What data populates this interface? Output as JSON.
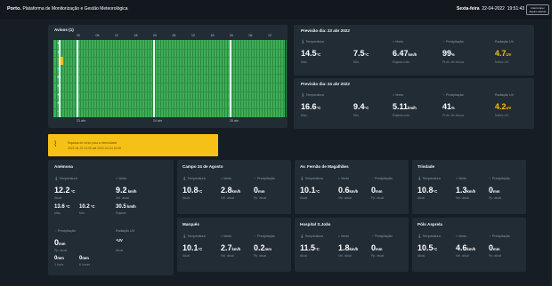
{
  "header": {
    "city": "Porto",
    "subtitle": "Plataforma de Monitorização e Gestão Meteorológica",
    "day": "Sexta-feira",
    "date": "22-04-2022",
    "time": "19:51:43",
    "button": "Interromper Alguns alertas"
  },
  "alerts_card": {
    "title": "Avisos (1)",
    "hours": [
      "00",
      "06",
      "12",
      "18",
      "00",
      "06",
      "12",
      "18",
      "00",
      "06",
      "12"
    ],
    "days": [
      "23 abr",
      "24 abr",
      "25 abr"
    ],
    "row_icons": [
      "wind-icon",
      "rain-icon",
      "thunderstorm-icon",
      "snow-icon",
      "fog-icon",
      "heat-icon",
      "cold-icon",
      "sea-icon",
      "fire-icon"
    ],
    "colors": {
      "level_green": "#3cae57",
      "level_yellow": "#f5c117"
    }
  },
  "alert_banner": {
    "line1": "Rajadas de vento para a intensidade",
    "line2": "2022-04-22 13:00 até 2022-04-24 19:00"
  },
  "forecast": [
    {
      "title": "Previsão dia: 23 abr 2022",
      "labels": {
        "temp": "Temperatura",
        "wind": "Vento",
        "precip": "Precipitação",
        "uv": "Radiação UV"
      },
      "max_temp": "14.5",
      "min_temp": "7.5",
      "temp_unit": "°C",
      "wind": "6.47",
      "wind_unit": "km/h",
      "precip": "99",
      "precip_unit": "%",
      "uv": "4.7",
      "uv_unit": "UV",
      "subs": {
        "max": "Máx.",
        "min": "Mín.",
        "gust": "Rajada máx",
        "prob": "Prob. de chuva",
        "uv_idx": "Índice UV"
      }
    },
    {
      "title": "Previsão dia: 24 abr 2022",
      "labels": {
        "temp": "Temperatura",
        "wind": "Vento",
        "precip": "Precipitação",
        "uv": "Radiação UV"
      },
      "max_temp": "16.6",
      "min_temp": "9.4",
      "temp_unit": "°C",
      "wind": "5.11",
      "wind_unit": "km/h",
      "precip": "41",
      "precip_unit": "%",
      "uv": "4.2",
      "uv_unit": "UV",
      "subs": {
        "max": "Máx.",
        "min": "Mín.",
        "gust": "Rajada máx",
        "prob": "Prob. de chuva",
        "uv_idx": "Índice UV"
      }
    }
  ],
  "anemona": {
    "title": "Anémona",
    "temp_label": "Temperatura",
    "wind_label": "Vento",
    "temp": "12.2",
    "temp_unit": "°C",
    "temp_sub": "Atual",
    "wind": "9.2",
    "wind_unit": "km/h",
    "wind_sub": "Vel. atual",
    "max": "13.6",
    "max_unit": "°C",
    "min": "10.2",
    "min_unit": "°C",
    "max_sub": "Máx.",
    "min_sub": "Mín.",
    "gust": "30.5",
    "gust_unit": "km/h",
    "gust_sub": "Rajada",
    "precip_label": "Precipitação",
    "uv_label": "Radiação UV",
    "precip": "0",
    "precip_unit": "mm",
    "precip_sub": "Pp. atual",
    "uv": "-",
    "uv_unit": "UV",
    "uv_sub": "Atual",
    "p1h": "0",
    "p1h_unit": "mm",
    "p1h_sub": "1 hora",
    "p6h": "0",
    "p6h_unit": "mm",
    "p6h_sub": "6 horas"
  },
  "stations": [
    {
      "name": "Campo 24 de Agosto",
      "temp": "10.8",
      "wind": "2.8",
      "precip": "0"
    },
    {
      "name": "Av. Fernão de Magalhães",
      "temp": "10.1",
      "wind": "0.6",
      "precip": "0"
    },
    {
      "name": "Trindade",
      "temp": "10.8",
      "wind": "1.3",
      "precip": "0"
    },
    {
      "name": "Marquês",
      "temp": "10.1",
      "wind": "2.7",
      "precip": "0.2"
    },
    {
      "name": "Hospital S.João",
      "temp": "11.5",
      "wind": "1.8",
      "precip": "0"
    },
    {
      "name": "Pólo Asprela",
      "temp": "10.5",
      "wind": "4.6",
      "precip": "0"
    }
  ],
  "station_labels": {
    "temp": "Temperatura",
    "wind": "Vento",
    "precip": "Precipitação",
    "temp_sub": "Atual",
    "wind_sub": "Vel. atual",
    "precip_sub": "Pp. atual",
    "temp_unit": "°C",
    "wind_unit": "km/h",
    "precip_unit": "mm"
  }
}
